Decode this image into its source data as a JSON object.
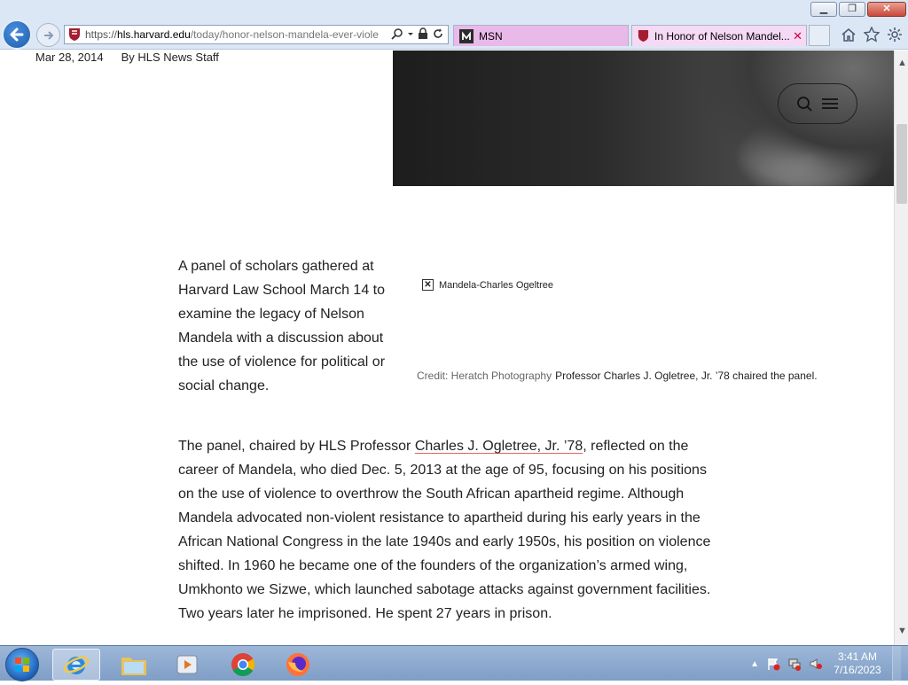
{
  "browser": {
    "url_prefix": "https://",
    "url_domain": "hls.harvard.edu",
    "url_path": "/today/honor-nelson-mandela-ever-viole",
    "tabs": [
      {
        "label": "MSN"
      },
      {
        "label": "In Honor of Nelson Mandel..."
      }
    ]
  },
  "article": {
    "date": "Mar 28, 2014",
    "author": "By HLS News Staff",
    "intro": "A panel of scholars gathered at Harvard Law School March 14 to examine the legacy of Nelson Mandela with a discussion about the use of violence for political  or social change.",
    "figure": {
      "alt_text": "Mandela-Charles Ogeltree",
      "credit": "Credit: Heratch Photography",
      "caption": "Professor Charles J. Ogletree, Jr. ’78 chaired the panel."
    },
    "body_before_link": "The panel, chaired by HLS Professor ",
    "body_link": "Charles J. Ogletree, Jr. ’78",
    "body_after_link": ", reflected on the career of Mandela, who died Dec. 5, 2013 at the age of 95, focusing on his positions on the use of violence to overthrow the South African apartheid regime. Although Mandela advocated non-violent resistance to apartheid during his early years in the African National Congress in the late 1940s and early 1950s, his position on violence shifted. In 1960 he became one of the founders of the organization’s armed wing, Umkhonto we Sizwe, which launched sabotage attacks against government facilities. Two years later he imprisoned. He spent 27 years in prison."
  },
  "taskbar": {
    "time": "3:41 AM",
    "date": "7/16/2023"
  },
  "colors": {
    "harvard_crimson": "#a51c30",
    "link_underline": "#e06060"
  }
}
